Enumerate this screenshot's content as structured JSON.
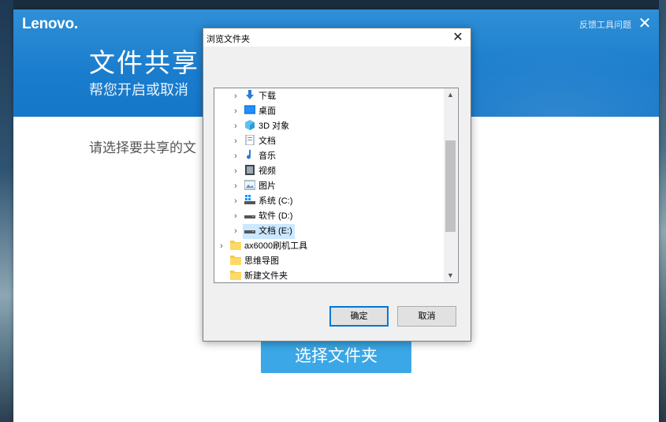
{
  "app": {
    "logo": "Lenovo",
    "feedback_link": "反馈工具问题",
    "close_label": "✕",
    "title": "文件共享",
    "subtitle": "帮您开启或取消",
    "prompt": "请选择要共享的文",
    "select_folder_button": "选择文件夹"
  },
  "dialog": {
    "title": "浏览文件夹",
    "close_label": "✕",
    "ok_button": "确定",
    "cancel_button": "取消",
    "tree_items": [
      {
        "label": "下载",
        "icon": "download-arrow-icon",
        "level": 1,
        "expandable": true
      },
      {
        "label": "桌面",
        "icon": "desktop-icon",
        "level": 1,
        "expandable": true
      },
      {
        "label": "3D 对象",
        "icon": "3d-objects-icon",
        "level": 1,
        "expandable": true
      },
      {
        "label": "文档",
        "icon": "documents-icon",
        "level": 1,
        "expandable": true
      },
      {
        "label": "音乐",
        "icon": "music-icon",
        "level": 1,
        "expandable": true
      },
      {
        "label": "视频",
        "icon": "video-icon",
        "level": 1,
        "expandable": true
      },
      {
        "label": "图片",
        "icon": "pictures-icon",
        "level": 1,
        "expandable": true
      },
      {
        "label": "系统 (C:)",
        "icon": "system-drive-icon",
        "level": 1,
        "expandable": true
      },
      {
        "label": "软件 (D:)",
        "icon": "drive-icon",
        "level": 1,
        "expandable": true
      },
      {
        "label": "文档 (E:)",
        "icon": "drive-icon",
        "level": 1,
        "expandable": true,
        "selected": true
      },
      {
        "label": "ax6000刷机工具",
        "icon": "folder-icon",
        "level": 0,
        "expandable": true
      },
      {
        "label": "思维导图",
        "icon": "folder-icon",
        "level": 0,
        "expandable": false
      },
      {
        "label": "新建文件夹",
        "icon": "folder-icon",
        "level": 0,
        "expandable": false
      }
    ]
  },
  "colors": {
    "header_blue": "#1a7ccd",
    "button_blue": "#3ba7e6",
    "selection": "#cce8ff",
    "default_button_border": "#0078d7"
  }
}
